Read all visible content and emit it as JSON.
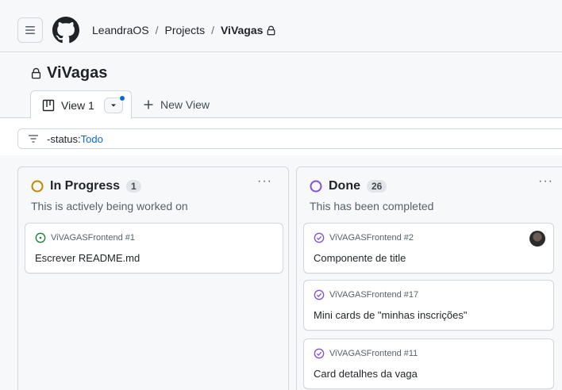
{
  "header": {
    "owner": "LeandraOS",
    "projects": "Projects",
    "current": "ViVagas",
    "separator": "/"
  },
  "project": {
    "title": "ViVagas"
  },
  "views": {
    "tabs": [
      {
        "label": "View 1"
      }
    ],
    "new_view": "New View"
  },
  "filter": {
    "key": "-status:",
    "value": "Todo"
  },
  "columns": [
    {
      "title": "In Progress",
      "count": "1",
      "description": "This is actively being worked on",
      "status_color": "#bf8700",
      "cards": [
        {
          "ref": "ViVAGASFrontend #1",
          "title": "Escrever README.md",
          "state": "open"
        }
      ]
    },
    {
      "title": "Done",
      "count": "26",
      "description": "This has been completed",
      "status_color": "#8250df",
      "cards": [
        {
          "ref": "ViVAGASFrontend #2",
          "title": "Componente de title",
          "state": "closed",
          "assignee": true
        },
        {
          "ref": "ViVAGASFrontend #17",
          "title": "Mini cards de \"minhas inscrições\"",
          "state": "closed"
        },
        {
          "ref": "ViVAGASFrontend #11",
          "title": "Card detalhes da vaga",
          "state": "closed"
        }
      ]
    }
  ],
  "colors": {
    "open": "#1a7f37",
    "closed": "#8250df",
    "accent": "#0969da",
    "border": "#d0d7de"
  },
  "icons": {
    "menu": "hamburger-icon",
    "logo": "github-mark-icon",
    "lock": "lock-icon",
    "board": "board-view-icon",
    "filter": "filter-icon",
    "plus": "plus-icon",
    "kebab": "kebab-horizontal-icon"
  }
}
